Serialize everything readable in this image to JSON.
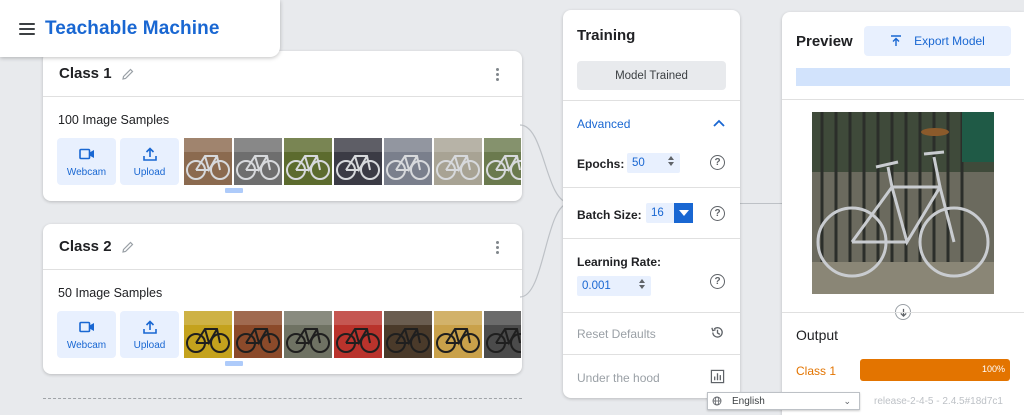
{
  "header": {
    "title": "Teachable Machine",
    "menu_icon": "hamburger-menu-icon"
  },
  "classes": [
    {
      "name": "Class 1",
      "samples_label": "100 Image Samples",
      "buttons": [
        {
          "label": "Webcam",
          "icon": "webcam-icon"
        },
        {
          "label": "Upload",
          "icon": "upload-icon"
        }
      ],
      "thumb_colors": [
        "#8b6a4f",
        "#6e6e6e",
        "#5c6b2e",
        "#3b3b45",
        "#7a7f8c",
        "#a8a394",
        "#6b7a4e"
      ]
    },
    {
      "name": "Class 2",
      "samples_label": "50 Image Samples",
      "buttons": [
        {
          "label": "Webcam",
          "icon": "webcam-icon"
        },
        {
          "label": "Upload",
          "icon": "upload-icon"
        }
      ],
      "thumb_colors": [
        "#c4a21d",
        "#8b4a2a",
        "#6f7263",
        "#b9332c",
        "#4a3a2a",
        "#c9a14a",
        "#4b4b4b"
      ]
    }
  ],
  "training": {
    "title": "Training",
    "model_button": "Model Trained",
    "advanced": "Advanced",
    "epochs_label": "Epochs:",
    "epochs_value": "50",
    "batch_label": "Batch Size:",
    "batch_value": "16",
    "lr_label": "Learning Rate:",
    "lr_value": "0.001",
    "reset": "Reset Defaults",
    "under_hood": "Under the hood",
    "help_glyph": "?"
  },
  "preview": {
    "title": "Preview",
    "export_button": "Export Model",
    "output_label": "Output",
    "outputs": [
      {
        "class": "Class 1",
        "percent": "100%",
        "fraction": 1.0,
        "color": "#e37400"
      }
    ]
  },
  "footer": {
    "language": "English",
    "release": "release-2-4-5 - 2.4.5#18d7c1"
  }
}
